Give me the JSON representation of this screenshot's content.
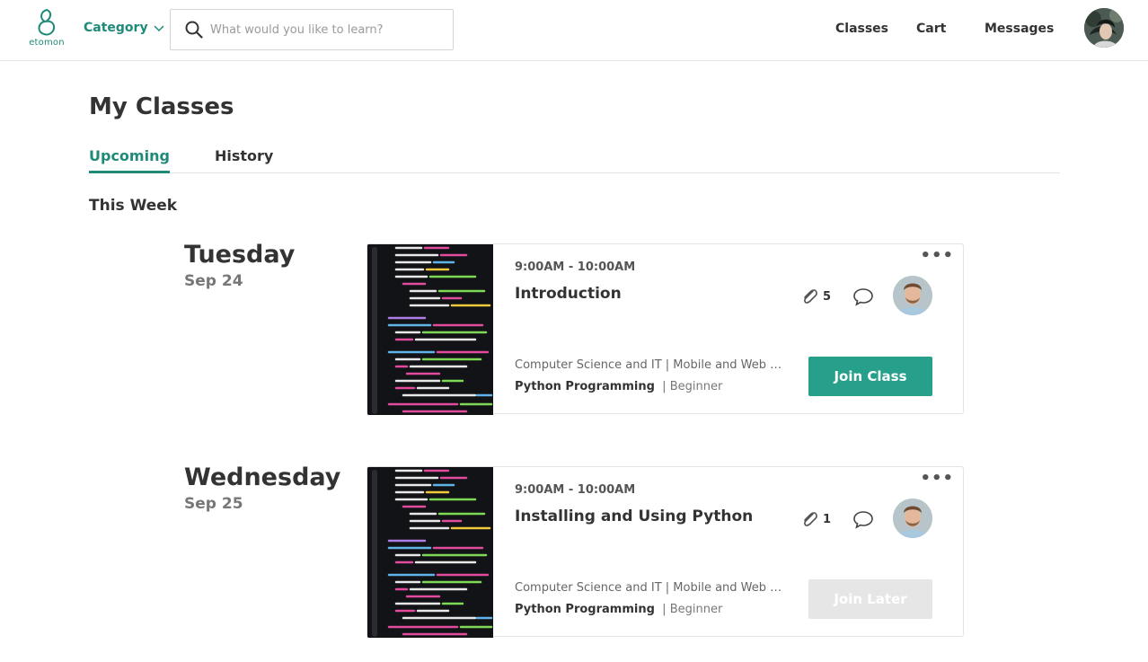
{
  "header": {
    "logo_text": "etomon",
    "category_label": "Category",
    "search_placeholder": "What would you like to learn?",
    "nav": [
      "Classes",
      "Cart",
      "Messages"
    ]
  },
  "page": {
    "title": "My Classes",
    "tabs": [
      "Upcoming",
      "History"
    ],
    "active_tab": "Upcoming",
    "section_title": "This Week"
  },
  "accent_color": "#26a08a",
  "classes": [
    {
      "day": "Tuesday",
      "date": "Sep 24",
      "time": "9:00AM - 10:00AM",
      "title": "Introduction",
      "attachments": "5",
      "categories": "Computer Science and IT | Mobile and Web Development",
      "course": "Python Programming",
      "level": "Beginner",
      "button_label": "Join Class",
      "button_enabled": true
    },
    {
      "day": "Wednesday",
      "date": "Sep 25",
      "time": "9:00AM - 10:00AM",
      "title": "Installing and Using Python",
      "attachments": "1",
      "categories": "Computer Science and IT | Mobile and Web Development",
      "course": "Python Programming",
      "level": "Beginner",
      "button_label": "Join Later",
      "button_enabled": false
    }
  ]
}
